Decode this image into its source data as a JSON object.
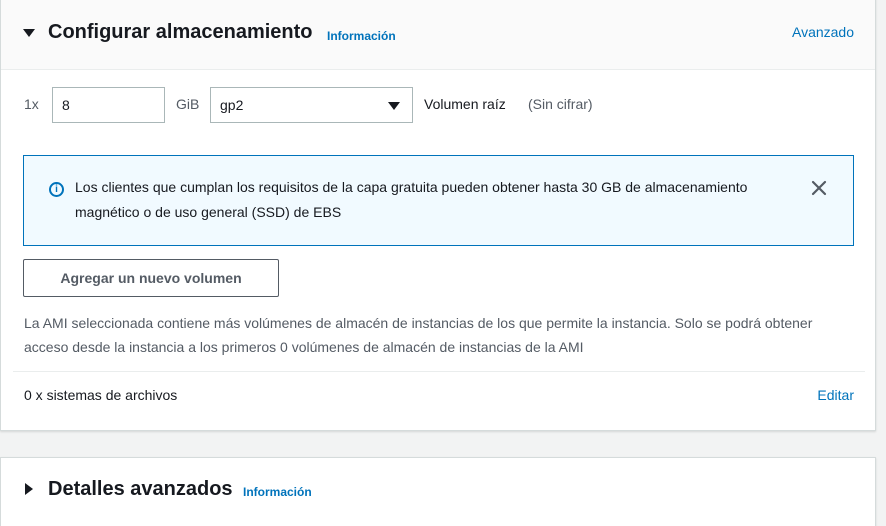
{
  "storage": {
    "title": "Configurar almacenamiento",
    "info_link": "Información",
    "advanced_link": "Avanzado",
    "volume": {
      "count_label": "1x",
      "size_value": "8",
      "size_unit": "GiB",
      "type_value": "gp2",
      "root_label": "Volumen raíz",
      "encryption_label": "(Sin cifrar)"
    },
    "alert": {
      "icon": "info-icon",
      "message": "Los clientes que cumplan los requisitos de la capa gratuita pueden obtener hasta 30 GB de almacenamiento magnético o de uso general (SSD) de EBS"
    },
    "add_volume_button": "Agregar un nuevo volumen",
    "ami_notice": "La AMI seleccionada contiene más volúmenes de almacén de instancias de los que permite la instancia. Solo se podrá obtener acceso desde la instancia a los primeros 0 volúmenes de almacén de instancias de la AMI",
    "filesystems_label": "0 x sistemas de archivos",
    "edit_link": "Editar"
  },
  "details": {
    "title": "Detalles avanzados",
    "info_link": "Información"
  },
  "colors": {
    "link": "#0073bb",
    "alert_background": "#f1faff",
    "text": "#16191f",
    "muted_text": "#545b64"
  }
}
